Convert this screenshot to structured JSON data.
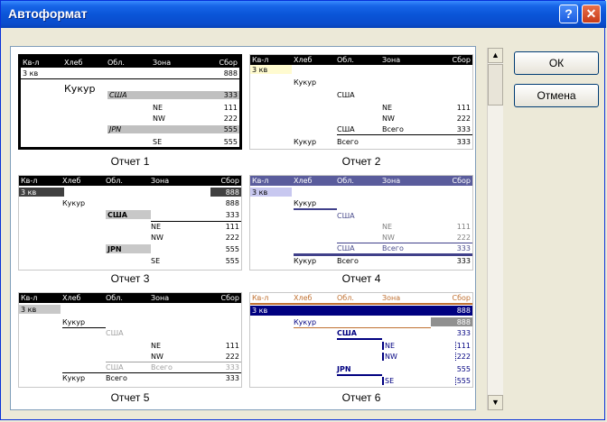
{
  "window": {
    "title": "Автоформат",
    "help_glyph": "?",
    "close_glyph": "✕"
  },
  "buttons": {
    "ok": "ОК",
    "cancel": "Отмена"
  },
  "scrollbar": {
    "up": "▲",
    "down": "▼"
  },
  "header": {
    "q": "Кв-л",
    "bread": "Хлеб",
    "region": "Обл.",
    "zone": "Зона",
    "total": "Сбор"
  },
  "labels": {
    "q3": "3 кв",
    "corn": "Кукур",
    "usa": "США",
    "ne": "NE",
    "nw": "NW",
    "jpn": "JPN",
    "se": "SE",
    "all": "Всего"
  },
  "values": {
    "v888": "888",
    "v333": "333",
    "v111": "111",
    "v222": "222",
    "v555": "555"
  },
  "reports": [
    {
      "caption": "Отчет 1",
      "selected": true
    },
    {
      "caption": "Отчет 2"
    },
    {
      "caption": "Отчет 3"
    },
    {
      "caption": "Отчет 4"
    },
    {
      "caption": "Отчет 5"
    },
    {
      "caption": "Отчет 6"
    }
  ],
  "colors": {
    "titlebar": "#0a55d8",
    "report4_header": "#5a5c9c",
    "report6_header": "#000080",
    "report6_accent": "#c07030"
  }
}
